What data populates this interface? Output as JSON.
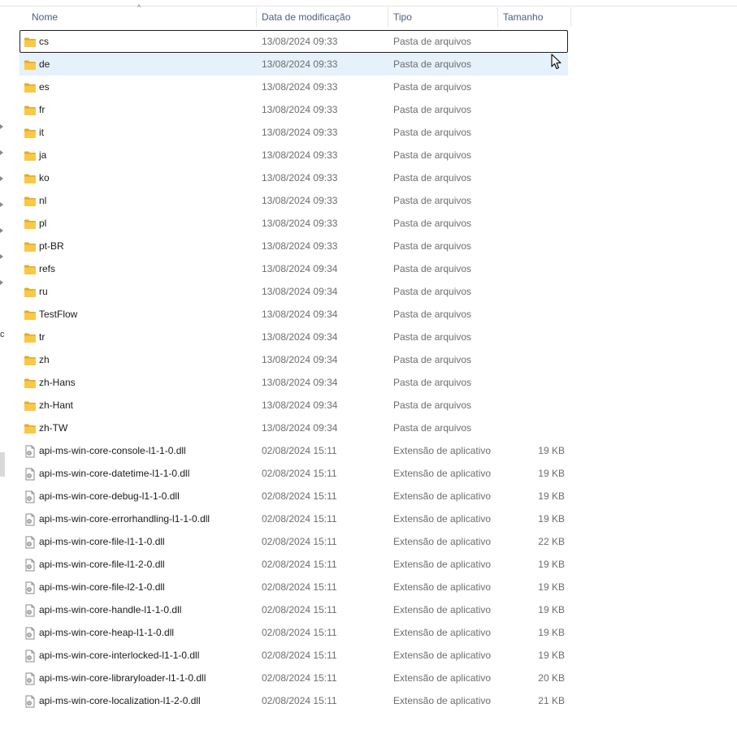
{
  "columns": {
    "name": "Nome",
    "date": "Data de modificação",
    "type": "Tipo",
    "size": "Tamanho"
  },
  "sort_indicator": "^",
  "left_pane_fragment": "c",
  "rows": [
    {
      "name": "cs",
      "date": "13/08/2024 09:33",
      "type": "Pasta de arquivos",
      "size": "",
      "icon": "folder-icon",
      "state": "focused"
    },
    {
      "name": "de",
      "date": "13/08/2024 09:33",
      "type": "Pasta de arquivos",
      "size": "",
      "icon": "folder-icon",
      "state": "hover"
    },
    {
      "name": "es",
      "date": "13/08/2024 09:33",
      "type": "Pasta de arquivos",
      "size": "",
      "icon": "folder-icon"
    },
    {
      "name": "fr",
      "date": "13/08/2024 09:33",
      "type": "Pasta de arquivos",
      "size": "",
      "icon": "folder-icon"
    },
    {
      "name": "it",
      "date": "13/08/2024 09:33",
      "type": "Pasta de arquivos",
      "size": "",
      "icon": "folder-icon"
    },
    {
      "name": "ja",
      "date": "13/08/2024 09:33",
      "type": "Pasta de arquivos",
      "size": "",
      "icon": "folder-icon"
    },
    {
      "name": "ko",
      "date": "13/08/2024 09:33",
      "type": "Pasta de arquivos",
      "size": "",
      "icon": "folder-icon"
    },
    {
      "name": "nl",
      "date": "13/08/2024 09:33",
      "type": "Pasta de arquivos",
      "size": "",
      "icon": "folder-icon"
    },
    {
      "name": "pl",
      "date": "13/08/2024 09:33",
      "type": "Pasta de arquivos",
      "size": "",
      "icon": "folder-icon"
    },
    {
      "name": "pt-BR",
      "date": "13/08/2024 09:33",
      "type": "Pasta de arquivos",
      "size": "",
      "icon": "folder-icon"
    },
    {
      "name": "refs",
      "date": "13/08/2024 09:34",
      "type": "Pasta de arquivos",
      "size": "",
      "icon": "folder-icon"
    },
    {
      "name": "ru",
      "date": "13/08/2024 09:34",
      "type": "Pasta de arquivos",
      "size": "",
      "icon": "folder-icon"
    },
    {
      "name": "TestFlow",
      "date": "13/08/2024 09:34",
      "type": "Pasta de arquivos",
      "size": "",
      "icon": "folder-icon"
    },
    {
      "name": "tr",
      "date": "13/08/2024 09:34",
      "type": "Pasta de arquivos",
      "size": "",
      "icon": "folder-icon"
    },
    {
      "name": "zh",
      "date": "13/08/2024 09:34",
      "type": "Pasta de arquivos",
      "size": "",
      "icon": "folder-icon"
    },
    {
      "name": "zh-Hans",
      "date": "13/08/2024 09:34",
      "type": "Pasta de arquivos",
      "size": "",
      "icon": "folder-icon"
    },
    {
      "name": "zh-Hant",
      "date": "13/08/2024 09:34",
      "type": "Pasta de arquivos",
      "size": "",
      "icon": "folder-icon"
    },
    {
      "name": "zh-TW",
      "date": "13/08/2024 09:34",
      "type": "Pasta de arquivos",
      "size": "",
      "icon": "folder-icon"
    },
    {
      "name": "api-ms-win-core-console-l1-1-0.dll",
      "date": "02/08/2024 15:11",
      "type": "Extensão de aplicativo",
      "size": "19 KB",
      "icon": "dll-file-icon"
    },
    {
      "name": "api-ms-win-core-datetime-l1-1-0.dll",
      "date": "02/08/2024 15:11",
      "type": "Extensão de aplicativo",
      "size": "19 KB",
      "icon": "dll-file-icon"
    },
    {
      "name": "api-ms-win-core-debug-l1-1-0.dll",
      "date": "02/08/2024 15:11",
      "type": "Extensão de aplicativo",
      "size": "19 KB",
      "icon": "dll-file-icon"
    },
    {
      "name": "api-ms-win-core-errorhandling-l1-1-0.dll",
      "date": "02/08/2024 15:11",
      "type": "Extensão de aplicativo",
      "size": "19 KB",
      "icon": "dll-file-icon"
    },
    {
      "name": "api-ms-win-core-file-l1-1-0.dll",
      "date": "02/08/2024 15:11",
      "type": "Extensão de aplicativo",
      "size": "22 KB",
      "icon": "dll-file-icon"
    },
    {
      "name": "api-ms-win-core-file-l1-2-0.dll",
      "date": "02/08/2024 15:11",
      "type": "Extensão de aplicativo",
      "size": "19 KB",
      "icon": "dll-file-icon"
    },
    {
      "name": "api-ms-win-core-file-l2-1-0.dll",
      "date": "02/08/2024 15:11",
      "type": "Extensão de aplicativo",
      "size": "19 KB",
      "icon": "dll-file-icon"
    },
    {
      "name": "api-ms-win-core-handle-l1-1-0.dll",
      "date": "02/08/2024 15:11",
      "type": "Extensão de aplicativo",
      "size": "19 KB",
      "icon": "dll-file-icon"
    },
    {
      "name": "api-ms-win-core-heap-l1-1-0.dll",
      "date": "02/08/2024 15:11",
      "type": "Extensão de aplicativo",
      "size": "19 KB",
      "icon": "dll-file-icon"
    },
    {
      "name": "api-ms-win-core-interlocked-l1-1-0.dll",
      "date": "02/08/2024 15:11",
      "type": "Extensão de aplicativo",
      "size": "19 KB",
      "icon": "dll-file-icon"
    },
    {
      "name": "api-ms-win-core-libraryloader-l1-1-0.dll",
      "date": "02/08/2024 15:11",
      "type": "Extensão de aplicativo",
      "size": "20 KB",
      "icon": "dll-file-icon"
    },
    {
      "name": "api-ms-win-core-localization-l1-2-0.dll",
      "date": "02/08/2024 15:11",
      "type": "Extensão de aplicativo",
      "size": "21 KB",
      "icon": "dll-file-icon"
    }
  ],
  "colors": {
    "header_text": "#4c607a",
    "hover_row": "#e5f1fb",
    "folder": "#f7c948",
    "secondary_text": "#6d6d6d"
  }
}
